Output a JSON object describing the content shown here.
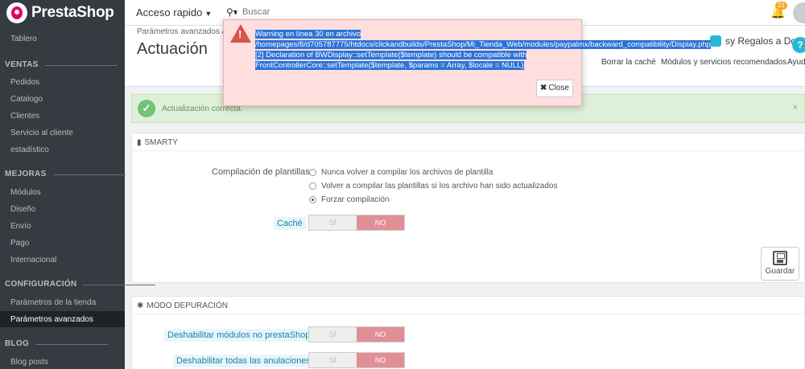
{
  "topbar": {
    "logo_text": "PrestaShop",
    "quick_access": "Acceso rapido",
    "search_placeholder": "Buscar",
    "notifications_count": "21"
  },
  "sidebar": {
    "items": [
      {
        "type": "item",
        "label": "Tablero"
      },
      {
        "type": "head",
        "label": "VENTAS"
      },
      {
        "type": "item",
        "label": "Pedidos"
      },
      {
        "type": "item",
        "label": "Catalogo"
      },
      {
        "type": "item",
        "label": "Clientes"
      },
      {
        "type": "item",
        "label": "Servicio al cliente"
      },
      {
        "type": "item",
        "label": "estadístico"
      },
      {
        "type": "head",
        "label": "MEJORAS"
      },
      {
        "type": "item",
        "label": "Módulos"
      },
      {
        "type": "item",
        "label": "Diseño"
      },
      {
        "type": "item",
        "label": "Envío"
      },
      {
        "type": "item",
        "label": "Pago"
      },
      {
        "type": "item",
        "label": "Internacional"
      },
      {
        "type": "head",
        "label": "CONFIGURACIÓN"
      },
      {
        "type": "item",
        "label": "Parámetros de la tienda"
      },
      {
        "type": "item",
        "label": "Parámetros avanzados",
        "active": true
      },
      {
        "type": "head",
        "label": "BLOG"
      },
      {
        "type": "item",
        "label": "Blog posts"
      }
    ]
  },
  "header": {
    "breadcrumb": "Parámetros avanzados  /",
    "title": "Actuación",
    "shop_title": "sy Regalos a Domicil",
    "links": [
      "Borrar la caché",
      "Módulos y servicios recomendados",
      "Ayuda"
    ]
  },
  "alert": {
    "text": "Actualización correcta."
  },
  "smarty": {
    "heading": "SMARTY",
    "compile_label": "Compilación de plantillas",
    "options": [
      "Nunca volver a compilar los archivos de plantilla",
      "Volver a compilar las plantillas si los archivo han sido actualizados",
      "Forzar compilación"
    ],
    "selected_option": 2,
    "cache_label": "Caché",
    "yes": "SÍ",
    "no": "NO",
    "save": "Guardar"
  },
  "debug": {
    "heading": "MODO DEPURACIÓN",
    "disable_modules_label": "Deshabilitar módulos no prestaShop",
    "disable_overrides_label": "Deshabilitar todas las anulaciones",
    "yes": "SÍ",
    "no": "NO"
  },
  "modal": {
    "lines": [
      "Warning en línea 30 en archivo",
      "/homepages/8/d705787775/htdocs/clickandbuilds/PrestaShop/Mi_Tienda_Web/modules/paypalmx/backward_compatibility/Display.php",
      "[2] Declaration of BWDisplay::setTemplate($template) should be compatible with",
      "FrontControllerCore::setTemplate($template, $params = Array, $locale = NULL)"
    ],
    "close_label": "Close"
  },
  "colors": {
    "sidebar_bg": "#363a41",
    "modal_bg": "#ffdede",
    "selection": "#2b73d8",
    "switch_no": "#e08f95",
    "success_bg": "#dff0d8"
  }
}
